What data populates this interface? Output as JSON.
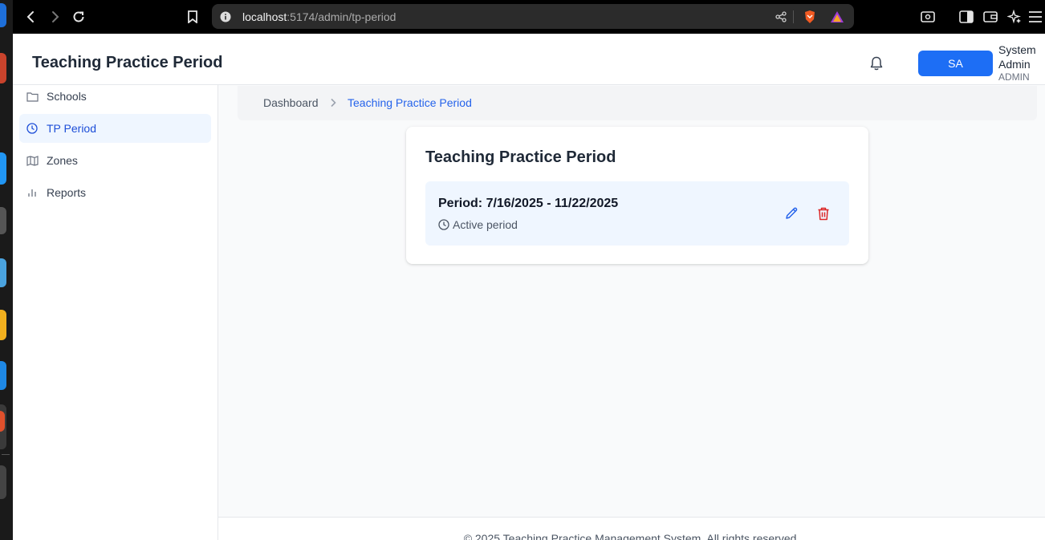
{
  "browser": {
    "url_host": "localhost",
    "url_path": ":5174/admin/tp-period"
  },
  "header": {
    "title": "Teaching Practice Period",
    "avatar_initials": "SA",
    "user_name": "System Admin",
    "user_role": "ADMIN"
  },
  "sidebar": {
    "items": [
      {
        "label": "Schools",
        "icon": "folder-icon"
      },
      {
        "label": "TP Period",
        "icon": "clock-icon",
        "active": true
      },
      {
        "label": "Zones",
        "icon": "map-icon"
      },
      {
        "label": "Reports",
        "icon": "bar-chart-icon"
      }
    ]
  },
  "breadcrumb": {
    "home": "Dashboard",
    "current": "Teaching Practice Period"
  },
  "card": {
    "title": "Teaching Practice Period",
    "period_text": "Period: 7/16/2025 - 11/22/2025",
    "status": "Active period"
  },
  "footer": {
    "text": "© 2025 Teaching Practice Management System. All rights reserved."
  },
  "colors": {
    "accent": "#2563eb",
    "avatar_bg": "#1d6ef5",
    "delete": "#dc2626",
    "active_bg": "#eff6ff"
  }
}
